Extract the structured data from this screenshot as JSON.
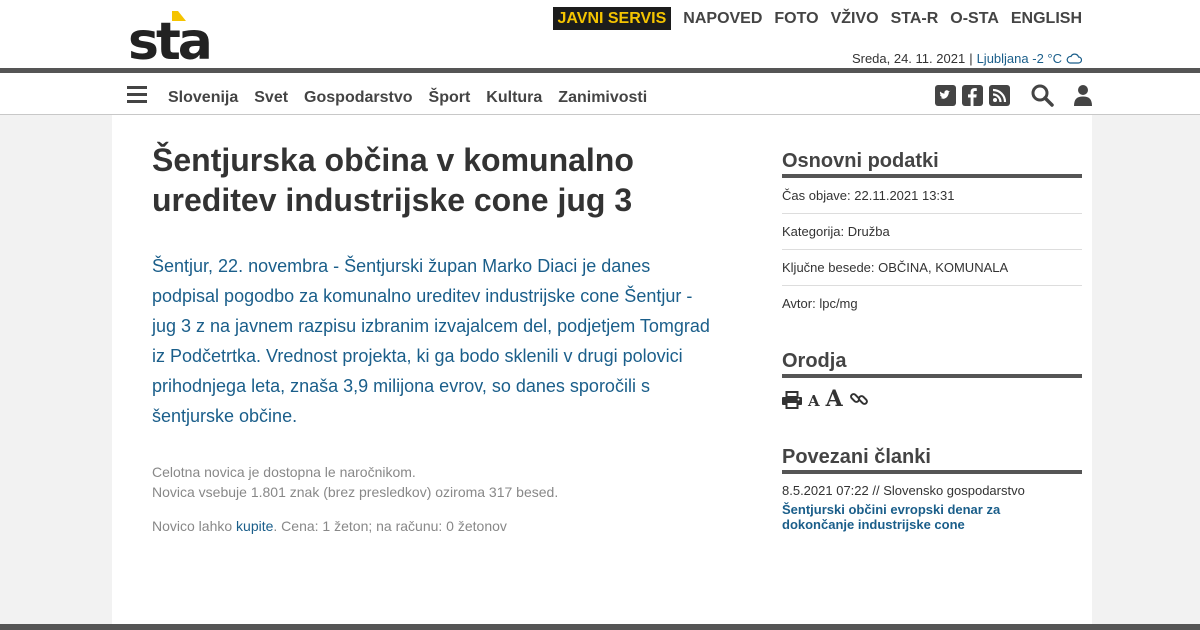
{
  "header": {
    "logo_text": "sta",
    "top_nav": [
      {
        "label": "JAVNI SERVIS",
        "highlight": true
      },
      {
        "label": "NAPOVED"
      },
      {
        "label": "FOTO"
      },
      {
        "label": "VŽIVO"
      },
      {
        "label": "STA-R"
      },
      {
        "label": "O-STA"
      },
      {
        "label": "ENGLISH"
      }
    ],
    "date": "Sreda, 24. 11. 2021",
    "separator": "|",
    "weather": "Ljubljana -2 °C",
    "weather_icon": "cloud-icon"
  },
  "main_nav": {
    "items": [
      "Slovenija",
      "Svet",
      "Gospodarstvo",
      "Šport",
      "Kultura",
      "Zanimivosti"
    ],
    "icons": [
      "twitter-icon",
      "facebook-icon",
      "rss-icon",
      "search-icon",
      "user-icon"
    ]
  },
  "article": {
    "headline": "Šentjurska občina v komunalno ureditev industrijske cone jug 3",
    "lead": "Šentjur, 22. novembra - Šentjurski župan Marko Diaci je danes podpisal pogodbo za komunalno ureditev industrijske cone Šentjur - jug 3 z na javnem razpisu izbranim izvajalcem del, podjetjem Tomgrad iz Podčetrtka. Vrednost projekta, ki ga bodo sklenili v drugi polovici prihodnjega leta, znaša 3,9 milijona evrov, so danes sporočili s šentjurske občine.",
    "subscribers_note": "Celotna novica je dostopna le naročnikom.",
    "length_note": "Novica vsebuje 1.801 znak (brez presledkov) oziroma 317 besed.",
    "buy_prefix": "Novico lahko ",
    "buy_link": "kupite",
    "buy_suffix": ". Cena: 1 žeton; na računu: 0 žetonov"
  },
  "sidebar": {
    "basic_title": "Osnovni podatki",
    "basic_rows": [
      "Čas objave: 22.11.2021 13:31",
      "Kategorija: Družba",
      "Ključne besede: OBČINA, KOMUNALA",
      "Avtor: lpc/mg"
    ],
    "tools_title": "Orodja",
    "tools": {
      "print_icon": "print-icon",
      "small_a": "A",
      "large_a": "A",
      "link_icon": "link-icon"
    },
    "related_title": "Povezani članki",
    "related": [
      {
        "meta": "8.5.2021 07:22 // Slovensko gospodarstvo",
        "title": "Šentjurski občini evropski denar za dokončanje industrijske cone"
      }
    ]
  },
  "colors": {
    "accent": "#1a5e8a",
    "highlight_bg": "#1c1c1c",
    "highlight_fg": "#f5c400",
    "dark_bar": "#555555",
    "logo_yellow": "#f5c400"
  }
}
